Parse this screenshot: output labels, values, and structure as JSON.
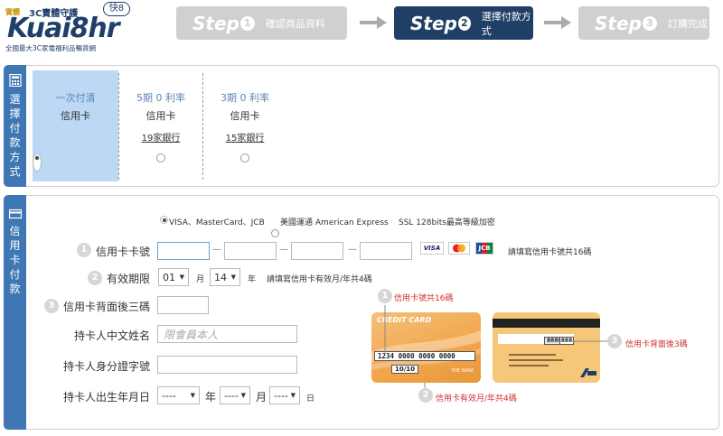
{
  "header": {
    "logo_tag": "實體",
    "logo_guard": "3C賣體守護",
    "logo_brand": "Kuai8hr",
    "logo_badge": "快8",
    "logo_sub": "全國最大3C家電福利品暢貨網",
    "steps": [
      {
        "big": "Step",
        "num": "1",
        "label": "確認商品資料",
        "active": false
      },
      {
        "big": "Step",
        "num": "2",
        "label": "選擇付款方式",
        "active": true
      },
      {
        "big": "Step",
        "num": "3",
        "label": "訂購完成",
        "active": false
      }
    ]
  },
  "payment": {
    "sidebar_label": [
      "選",
      "擇",
      "付",
      "款",
      "方",
      "式"
    ],
    "options": [
      {
        "title": "一次付清",
        "type": "信用卡",
        "banks": "",
        "selected": true
      },
      {
        "title": "5期 0 利率",
        "type": "信用卡",
        "banks": "19家銀行",
        "selected": false
      },
      {
        "title": "3期 0 利率",
        "type": "信用卡",
        "banks": "15家銀行",
        "selected": false
      }
    ]
  },
  "card_form": {
    "sidebar_label": [
      "信",
      "用",
      "卡",
      "付",
      "款"
    ],
    "card_types": {
      "visa_mc_jcb": "VISA、MasterCard、JCB",
      "amex": "美國運通 American Express",
      "ssl": "SSL 128bits最高等級加密"
    },
    "card_number_label": "信用卡卡號",
    "card_number_hint": "請填寫信用卡號共16碼",
    "logos": {
      "visa": "VISA",
      "jcb": "JCB"
    },
    "expiry_label": "有效期限",
    "expiry_month": "01",
    "expiry_month_unit": "月",
    "expiry_year": "14",
    "expiry_year_unit": "年",
    "expiry_hint": "請填寫信用卡有效月/年共4碼",
    "cvv_label": "信用卡背面後三碼",
    "name_label": "持卡人中文姓名",
    "name_placeholder": "限會員本人",
    "id_label": "持卡人身分證字號",
    "dob_label": "持卡人出生年月日",
    "dob_year": "----",
    "dob_year_unit": "年",
    "dob_month": "----",
    "dob_month_unit": "月",
    "dob_day": "----",
    "dob_day_unit": "日",
    "step_numbers": [
      "1",
      "2",
      "3"
    ]
  },
  "illustration": {
    "front_title": "CREDIT CARD",
    "front_number": "1234 0000 0000 0000",
    "front_expiry": "10/10",
    "front_bank": "THE BANK",
    "back_digits1": "8888",
    "back_digits2": "888",
    "callout1_num": "1",
    "callout1": "信用卡號共16碼",
    "callout2_num": "2",
    "callout2": "信用卡有效月/年共4碼",
    "callout3_num": "3",
    "callout3": "信用卡背面後3碼"
  },
  "colors": {
    "accent": "#3e77b3",
    "step_active": "#203f66",
    "step_inactive": "#d0d0d0",
    "selected_option": "#bcd8f5",
    "callout": "#d03030"
  }
}
